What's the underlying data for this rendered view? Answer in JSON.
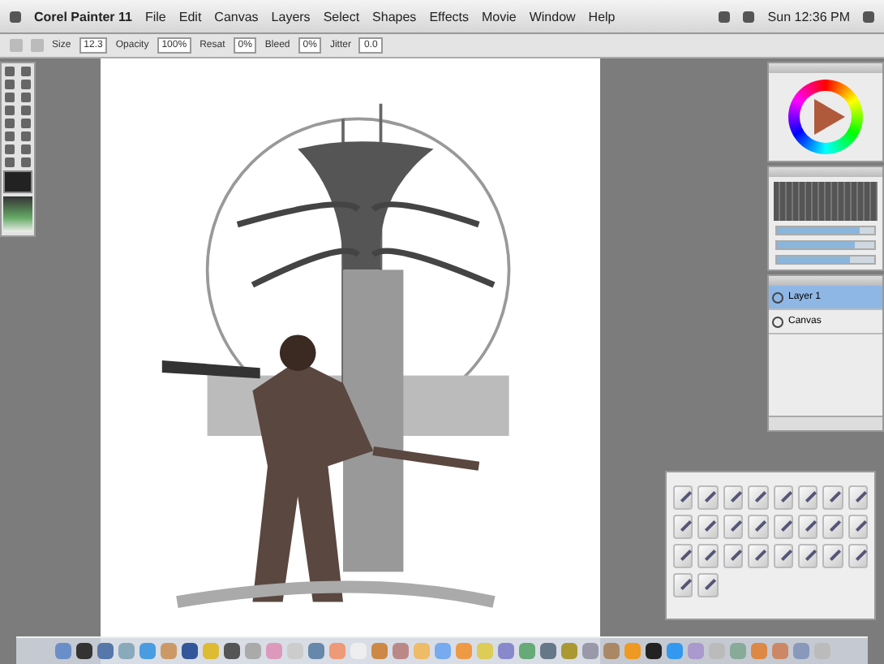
{
  "menu_bar": {
    "app_name": "Corel Painter 11",
    "menus": [
      "File",
      "Edit",
      "Canvas",
      "Layers",
      "Select",
      "Shapes",
      "Effects",
      "Movie",
      "Window",
      "Help"
    ],
    "clock": "Sun 12:36 PM"
  },
  "property_bar": {
    "fields": [
      {
        "label": "Size",
        "value": "12.3"
      },
      {
        "label": "Opacity",
        "value": "100%"
      },
      {
        "label": "Resat",
        "value": "0%"
      },
      {
        "label": "Bleed",
        "value": "0%"
      },
      {
        "label": "Jitter",
        "value": "0.0"
      }
    ]
  },
  "mixer_panel": {
    "sliders": [
      {
        "level": 0.85
      },
      {
        "level": 0.8
      },
      {
        "level": 0.75
      }
    ]
  },
  "layers_panel": {
    "layers": [
      {
        "name": "Layer 1",
        "selected": true
      },
      {
        "name": "Canvas",
        "selected": false
      }
    ]
  }
}
